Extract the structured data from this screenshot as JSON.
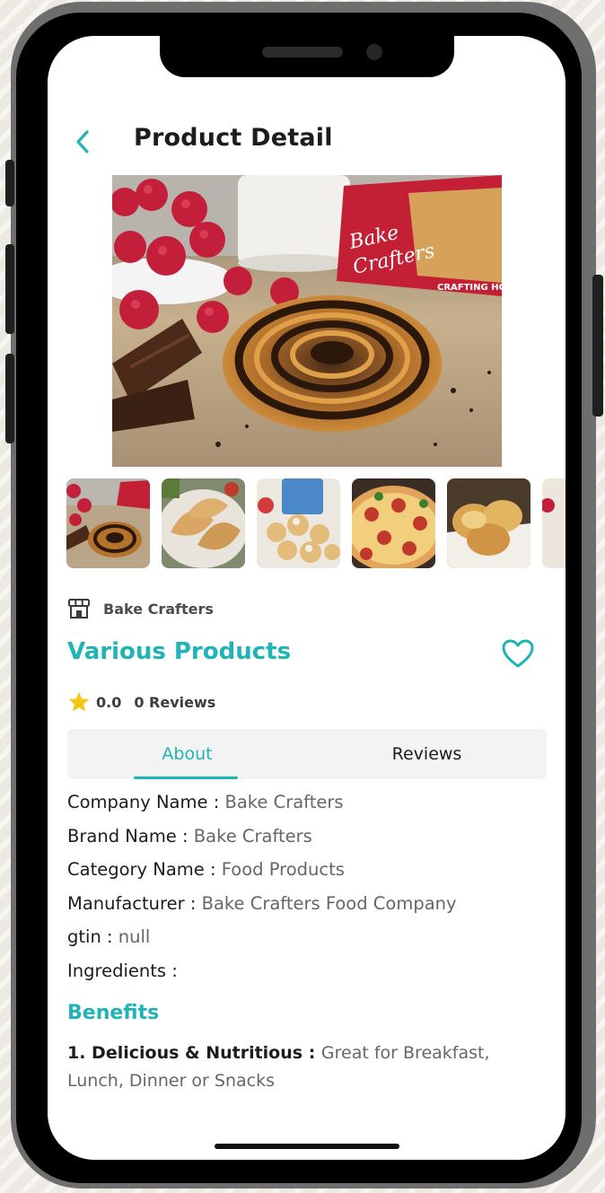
{
  "screen": {
    "title": "Product Detail"
  },
  "product": {
    "store_name": "Bake Crafters",
    "name": "Various Products",
    "rating": "0.0",
    "reviews_label": "0 Reviews"
  },
  "tabs": [
    {
      "label": "About",
      "active": true
    },
    {
      "label": "Reviews",
      "active": false
    }
  ],
  "details": [
    {
      "label": "Company Name : ",
      "value": "Bake Crafters"
    },
    {
      "label": "Brand  Name : ",
      "value": "Bake Crafters"
    },
    {
      "label": "Category  Name : ",
      "value": "Food Products"
    },
    {
      "label": "Manufacturer : ",
      "value": "Bake Crafters Food Company"
    },
    {
      "label": "gtin : ",
      "value": "null"
    },
    {
      "label": "Ingredients : ",
      "value": ""
    }
  ],
  "benefits": {
    "title": "Benefits",
    "items": [
      {
        "bold": "1. Delicious & Nutritious : ",
        "text": "Great for Breakfast, Lunch, Dinner or Snacks"
      }
    ]
  },
  "images": {
    "hero": "cinnamon-swirl-pastry-photo",
    "thumbnails": [
      "cinnamon-swirl-pastry-thumbnail",
      "empanadas-thumbnail",
      "cream-puffs-thumbnail",
      "pepperoni-pizza-thumbnail",
      "toasted-buns-thumbnail",
      "partial-thumbnail"
    ],
    "package_text": [
      "Bake",
      "Crafters",
      "CRAFTING HOM"
    ]
  },
  "colors": {
    "accent": "#20b3b8",
    "star": "#f5c518",
    "text": "#1c1c1c",
    "muted": "#666666"
  },
  "icons": {
    "back": "chevron-left-icon",
    "store": "storefront-icon",
    "favorite": "heart-outline-icon",
    "rating": "star-icon"
  }
}
